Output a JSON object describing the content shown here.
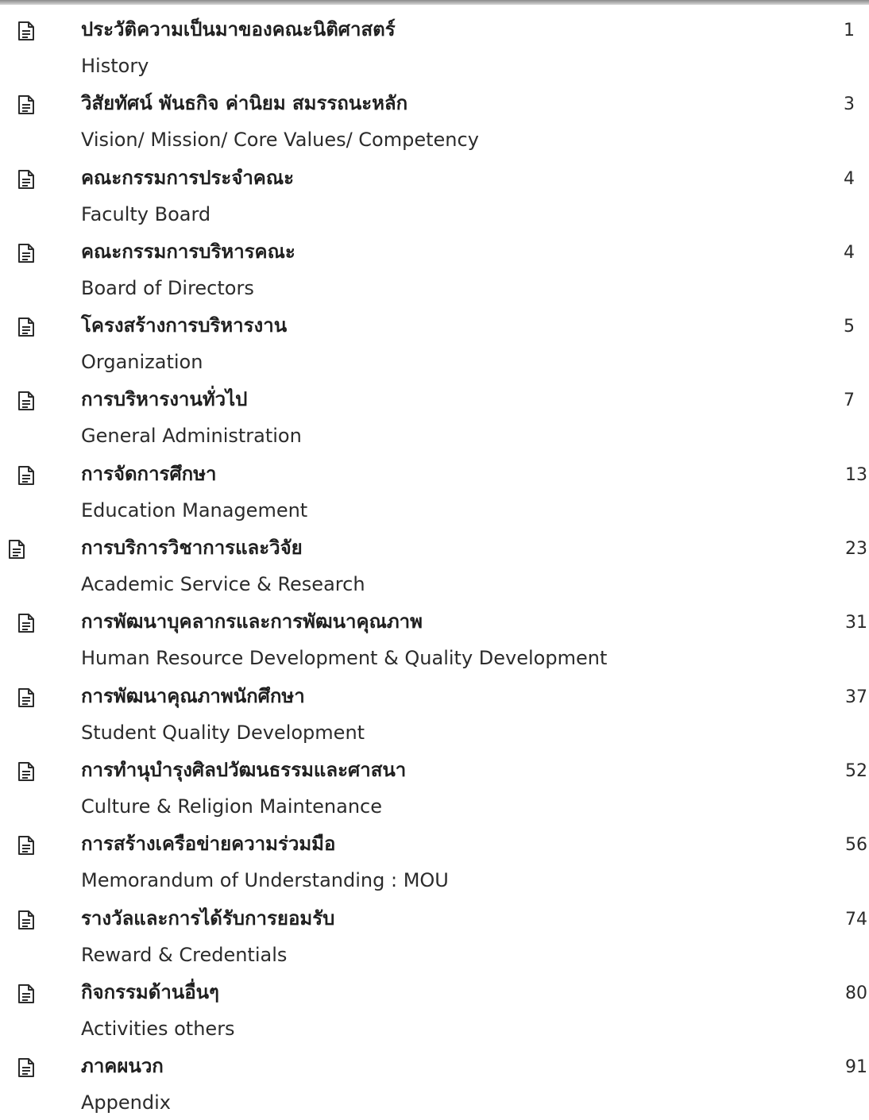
{
  "toc": {
    "entries": [
      {
        "title_th": "ประวัติความเป็นมาของคณะนิติศาสตร์",
        "title_en": "History",
        "page": "1"
      },
      {
        "title_th": "วิสัยทัศน์ พันธกิจ ค่านิยม สมรรถนะหลัก",
        "title_en": "Vision/ Mission/ Core Values/ Competency",
        "page": "3"
      },
      {
        "title_th": "คณะกรรมการประจำคณะ",
        "title_en": "Faculty Board",
        "page": "4"
      },
      {
        "title_th": "คณะกรรมการบริหารคณะ",
        "title_en": "Board of Directors",
        "page": "4"
      },
      {
        "title_th": "โครงสร้างการบริหารงาน",
        "title_en": "Organization",
        "page": "5"
      },
      {
        "title_th": "การบริหารงานทั่วไป",
        "title_en": "General Administration",
        "page": "7"
      },
      {
        "title_th": "การจัดการศึกษา",
        "title_en": "Education Management",
        "page": "13"
      },
      {
        "title_th": "การบริการวิชาการและวิจัย",
        "title_en": "Academic Service & Research",
        "page": "23"
      },
      {
        "title_th": "การพัฒนาบุคลากรและการพัฒนาคุณภาพ",
        "title_en": "Human Resource Development & Quality Development",
        "page": "31"
      },
      {
        "title_th": "การพัฒนาคุณภาพนักศึกษา",
        "title_en": "Student Quality Development",
        "page": "37"
      },
      {
        "title_th": "การทำนุบำรุงศิลปวัฒนธรรมและศาสนา",
        "title_en": "Culture & Religion Maintenance",
        "page": "52"
      },
      {
        "title_th": "การสร้างเครือข่ายความร่วมมือ",
        "title_en": "Memorandum of Understanding : MOU",
        "page": "56"
      },
      {
        "title_th": "รางวัลและการได้รับการยอมรับ",
        "title_en": "Reward & Credentials",
        "page": "74"
      },
      {
        "title_th": "กิจกรรมด้านอื่นๆ",
        "title_en": "Activities others",
        "page": "80"
      },
      {
        "title_th": "ภาคผนวก",
        "title_en": "Appendix",
        "page": "91"
      }
    ]
  }
}
